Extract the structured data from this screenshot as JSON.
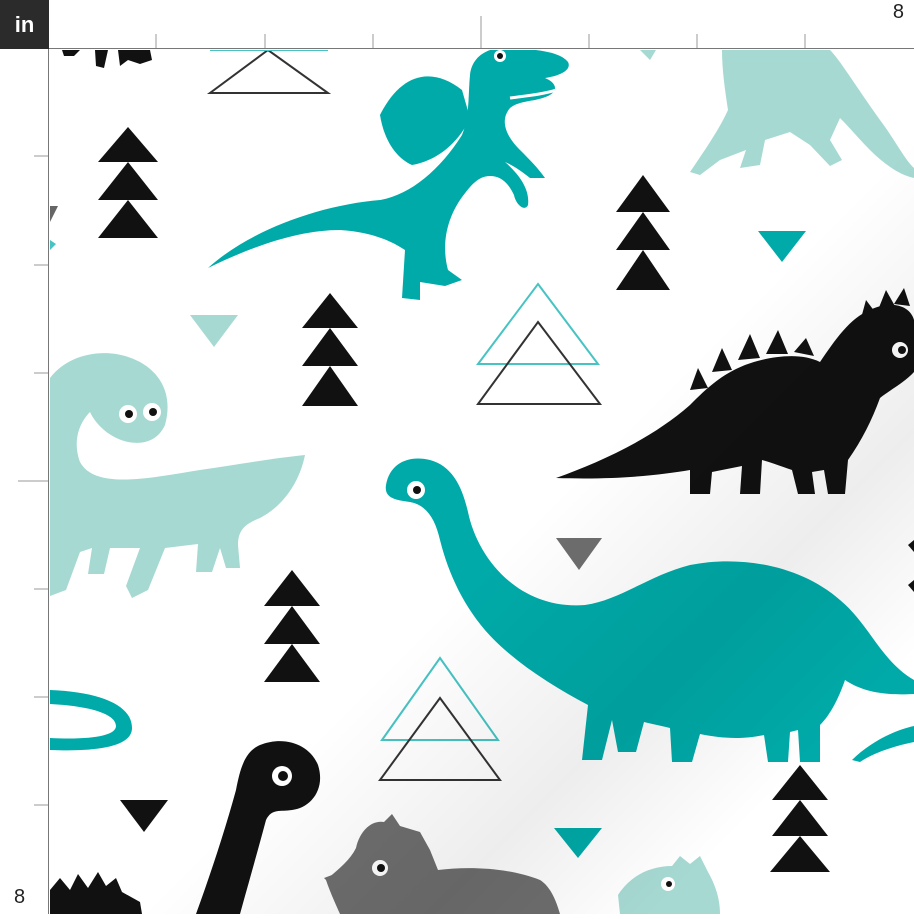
{
  "ruler": {
    "unit_label": "in",
    "top_end_label": "8",
    "left_end_label": "8"
  },
  "swatch": {
    "icons": [
      "dinosaur-icon",
      "triangle-tree-icon",
      "triangle-outline-icon",
      "triangle-icon"
    ],
    "colors": {
      "teal": "#00aaa8",
      "mint": "#a6d9d2",
      "black": "#111111",
      "gray": "#6e6e6e",
      "outline_teal": "#47c3c3",
      "outline_black": "#333333",
      "background": "#ffffff"
    }
  }
}
